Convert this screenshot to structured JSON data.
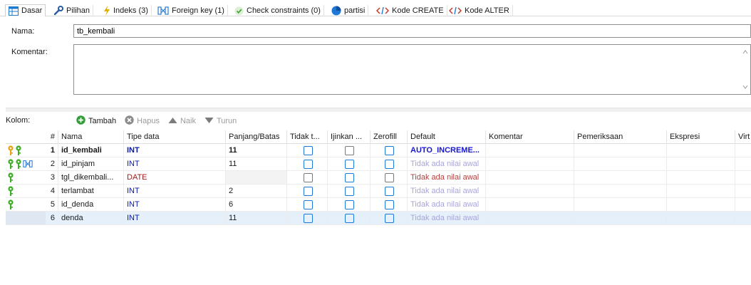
{
  "tabs": [
    {
      "label": "Dasar",
      "icon": "table-icon",
      "active": true
    },
    {
      "label": "Pilihan",
      "icon": "wrench-icon"
    },
    {
      "label": "Indeks (3)",
      "icon": "lightning-icon"
    },
    {
      "label": "Foreign key (1)",
      "icon": "foreign-key-icon"
    },
    {
      "label": "Check constraints (0)",
      "icon": "check-icon"
    },
    {
      "label": "partisi",
      "icon": "pie-icon"
    },
    {
      "label": "Kode CREATE",
      "icon": "code-icon"
    },
    {
      "label": "Kode ALTER",
      "icon": "code-icon"
    }
  ],
  "form": {
    "name_label": "Nama:",
    "name_value": "tb_kembali",
    "comment_label": "Komentar:",
    "comment_value": ""
  },
  "columns_toolbar": {
    "label": "Kolom:",
    "add": "Tambah",
    "delete": "Hapus",
    "up": "Naik",
    "down": "Turun"
  },
  "grid": {
    "headers": [
      "#",
      "Nama",
      "Tipe data",
      "Panjang/Batas",
      "Tidak t...",
      "Ijinkan ...",
      "Zerofill",
      "Default",
      "Komentar",
      "Pemeriksaan",
      "Ekspresi",
      "Virt"
    ],
    "rows": [
      {
        "num": "1",
        "name": "id_kembali",
        "type": "INT",
        "length": "11",
        "default": "AUTO_INCREME...",
        "keys": [
          "primary-key-icon",
          "index-key-icon"
        ]
      },
      {
        "num": "2",
        "name": "id_pinjam",
        "type": "INT",
        "length": "11",
        "default": "Tidak ada nilai awal",
        "keys": [
          "index-key-icon",
          "index-key-icon",
          "foreign-key-icon"
        ]
      },
      {
        "num": "3",
        "name": "tgl_dikembali...",
        "type": "DATE",
        "length": "",
        "default": "Tidak ada nilai awal",
        "keys": [
          "index-key-icon"
        ]
      },
      {
        "num": "4",
        "name": "terlambat",
        "type": "INT",
        "length": "2",
        "default": "Tidak ada nilai awal",
        "keys": [
          "index-key-icon"
        ]
      },
      {
        "num": "5",
        "name": "id_denda",
        "type": "INT",
        "length": "6",
        "default": "Tidak ada nilai awal",
        "keys": [
          "index-key-icon"
        ]
      },
      {
        "num": "6",
        "name": "denda",
        "type": "INT",
        "length": "11",
        "default": "Tidak ada nilai awal",
        "keys": []
      }
    ]
  },
  "colors": {
    "accent": "#1d7ad8",
    "selected_row": "#e5f0fb",
    "primary_key": "#e8a317",
    "index_key": "#3fae29",
    "type_int": "#0a1aa5",
    "type_date": "#9b1b1b"
  }
}
